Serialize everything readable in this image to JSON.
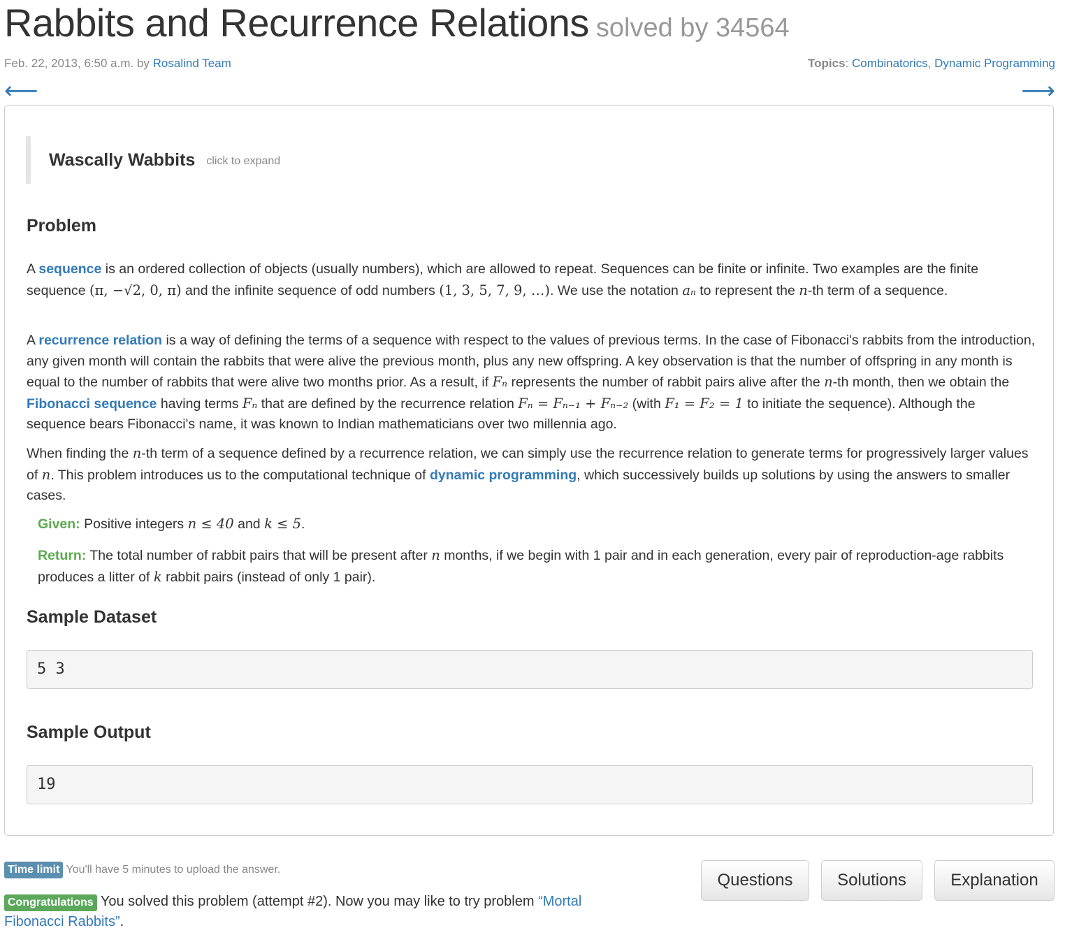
{
  "header": {
    "title": "Rabbits and Recurrence Relations",
    "solved_by": "solved by 34564",
    "date": "Feb. 22, 2013, 6:50 a.m. by",
    "author": "Rosalind Team",
    "topics_label": "Topics",
    "topics": [
      "Combinatorics",
      "Dynamic Programming"
    ],
    "prev_arrow": "⟵",
    "next_arrow": "⟶"
  },
  "story": {
    "title": "Wascally Wabbits",
    "hint": "click to expand"
  },
  "problem": {
    "heading": "Problem",
    "p1": {
      "t1": "A ",
      "link": "sequence",
      "t2": " is an ordered collection of objects (usually numbers), which are allowed to repeat. Sequences can be finite or infinite. Two examples are the finite sequence ",
      "m1": "(π, −√2, 0, π)",
      "t3": " and the infinite sequence of odd numbers ",
      "m2": "(1, 3, 5, 7, 9, …)",
      "t4": ". We use the notation ",
      "m3": "aₙ",
      "t5": " to represent the ",
      "m4": "n",
      "t6": "-th term of a sequence."
    },
    "p2": {
      "t1": "A ",
      "link1": "recurrence relation",
      "t2": " is a way of defining the terms of a sequence with respect to the values of previous terms. In the case of Fibonacci's rabbits from the introduction, any given month will contain the rabbits that were alive the previous month, plus any new offspring. A key observation is that the number of offspring in any month is equal to the number of rabbits that were alive two months prior. As a result, if ",
      "m1": "Fₙ",
      "t3": " represents the number of rabbit pairs alive after the ",
      "m2": "n",
      "t4": "-th month, then we obtain the ",
      "link2": "Fibonacci sequence",
      "t5": " having terms ",
      "m3": "Fₙ",
      "t6": " that are defined by the recurrence relation ",
      "m4": "Fₙ = Fₙ₋₁ + Fₙ₋₂",
      "t7": " (with ",
      "m5": "F₁ = F₂ = 1",
      "t8": " to initiate the sequence). Although the sequence bears Fibonacci's name, it was known to Indian mathematicians over two millennia ago."
    },
    "p3": {
      "t1": "When finding the ",
      "m1": "n",
      "t2": "-th term of a sequence defined by a recurrence relation, we can simply use the recurrence relation to generate terms for progressively larger values of ",
      "m2": "n",
      "t3": ". This problem introduces us to the computational technique of ",
      "link": "dynamic programming",
      "t4": ", which successively builds up solutions by using the answers to smaller cases."
    },
    "given": {
      "label": "Given:",
      "t1": " Positive integers ",
      "m1": "n ≤ 40",
      "t2": " and ",
      "m2": "k ≤ 5",
      "t3": "."
    },
    "return": {
      "label": "Return:",
      "t1": " The total number of rabbit pairs that will be present after ",
      "m1": "n",
      "t2": " months, if we begin with 1 pair and in each generation, every pair of reproduction-age rabbits produces a litter of ",
      "m2": "k",
      "t3": " rabbit pairs (instead of only 1 pair)."
    }
  },
  "sample_dataset": {
    "heading": "Sample Dataset",
    "value": "5 3"
  },
  "sample_output": {
    "heading": "Sample Output",
    "value": "19"
  },
  "footer": {
    "time_limit_label": "Time limit",
    "time_limit_text": "You'll have 5 minutes to upload the answer.",
    "congrats_label": "Congratulations",
    "congrats_text": " You solved this problem (attempt #2). Now you may like to try problem ",
    "next_problem": "“Mortal Fibonacci Rabbits”",
    "period": "."
  },
  "buttons": {
    "questions": "Questions",
    "solutions": "Solutions",
    "explanation": "Explanation"
  }
}
